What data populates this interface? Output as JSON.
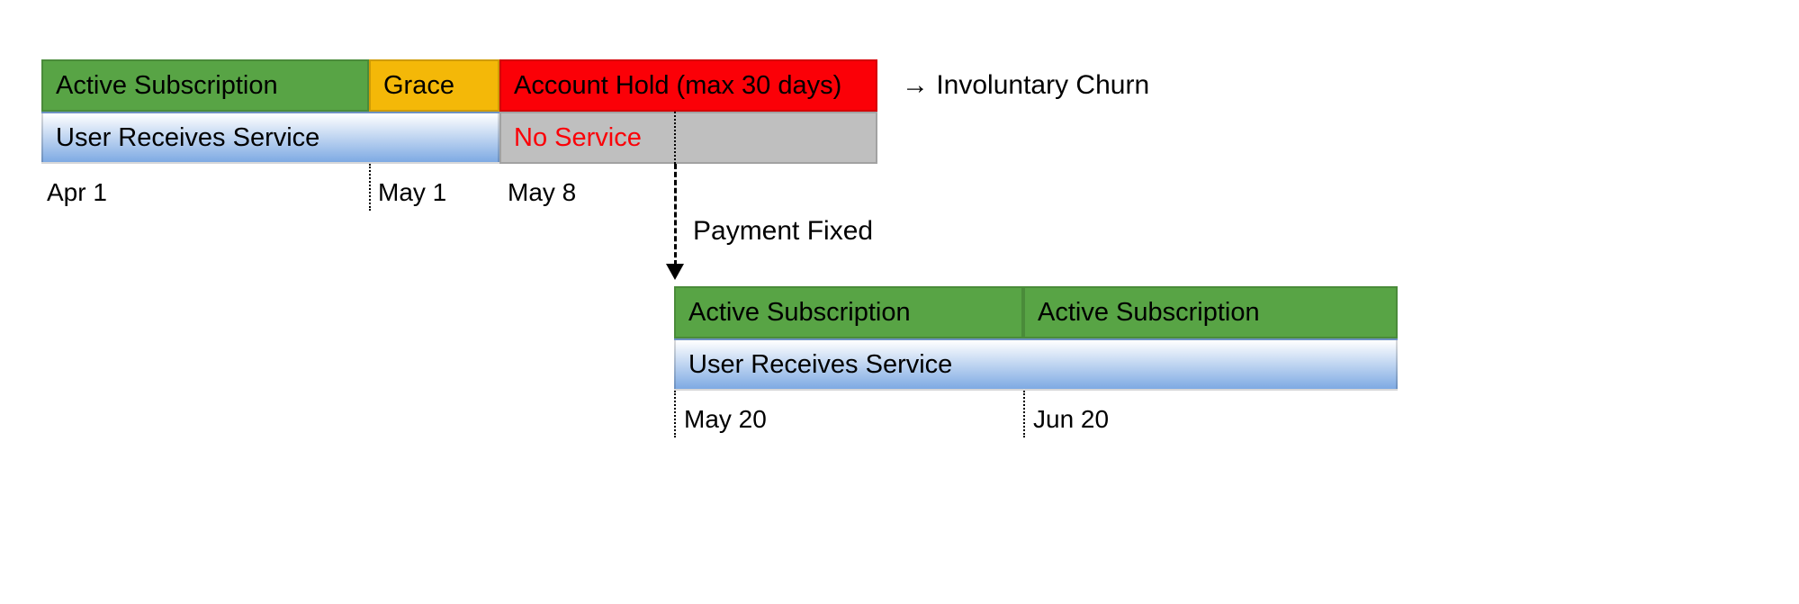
{
  "top": {
    "active": "Active Subscription",
    "grace": "Grace",
    "hold": "Account Hold (max 30 days)",
    "service": "User Receives Service",
    "noService": "No Service",
    "churn": "→ Involuntary Churn",
    "dates": {
      "apr1": "Apr 1",
      "may1": "May 1",
      "may8": "May 8"
    }
  },
  "middle": {
    "paymentFixed": "Payment Fixed"
  },
  "bottom": {
    "active1": "Active Subscription",
    "active2": "Active Subscription",
    "service": "User Receives Service",
    "dates": {
      "may20": "May 20",
      "jun20": "Jun 20"
    }
  }
}
